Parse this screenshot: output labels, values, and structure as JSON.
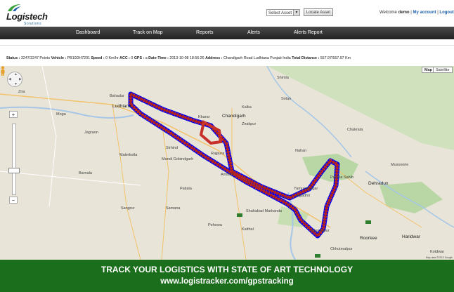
{
  "header": {
    "logo_text": "Logistech",
    "logo_sub": "Solutions",
    "asset_select": {
      "value": "Select Asset"
    },
    "locate_button": "Locate Asset",
    "welcome_prefix": "Welcome",
    "user_name": "demo",
    "my_account": "My account",
    "separator": "|",
    "logout": "Logout"
  },
  "nav": {
    "items": [
      {
        "label": "Dashboard"
      },
      {
        "label": "Track on Map"
      },
      {
        "label": "Reports"
      },
      {
        "label": "Alerts"
      },
      {
        "label": "Alerts Report"
      }
    ]
  },
  "status": {
    "status_label": "Status :",
    "status_value": "3247/3247 Points",
    "vehicle_label": "Vehicle :",
    "vehicle_value": "PB10DH7201",
    "speed_label": "Speed :",
    "speed_value": "0 Km/hr",
    "acc_label": "ACC :",
    "acc_value": "0",
    "gps_label": "GPS :",
    "gps_value": "a",
    "datetime_label": "Date-Time :",
    "datetime_value": "2013-10-08 18:56:26",
    "address_label": "Address :",
    "address_value": "Chandigarh Road Ludhiana Punjab India",
    "distance_label": "Total Distance :",
    "distance_value": "557.97/557.97 Km"
  },
  "map": {
    "map_type_map": "Map",
    "map_type_satellite": "Satellite",
    "zoom_in": "+",
    "zoom_out": "−",
    "colors": {
      "route_track": "#0000ee",
      "route_points": "#c8302a",
      "water": "#a6c6e8",
      "forest": "#b8d7a4"
    },
    "labels": [
      {
        "text": "Ludhiana",
        "kind": "city"
      },
      {
        "text": "Chandigarh",
        "kind": "city"
      },
      {
        "text": "Dehradun",
        "kind": "city"
      },
      {
        "text": "Roorkee",
        "kind": "city"
      },
      {
        "text": "Haridwar",
        "kind": "city"
      },
      {
        "text": "Moga",
        "kind": "town"
      },
      {
        "text": "Barnala",
        "kind": "town"
      },
      {
        "text": "Patiala",
        "kind": "town"
      },
      {
        "text": "Ambala",
        "kind": "town"
      },
      {
        "text": "Sangrur",
        "kind": "town"
      },
      {
        "text": "Zira",
        "kind": "town"
      },
      {
        "text": "Jagraon",
        "kind": "town"
      },
      {
        "text": "Kalka",
        "kind": "town"
      },
      {
        "text": "Zirakpur",
        "kind": "town"
      },
      {
        "text": "Rajpura",
        "kind": "town"
      },
      {
        "text": "Shimla",
        "kind": "town"
      },
      {
        "text": "Solan",
        "kind": "town"
      },
      {
        "text": "Nahan",
        "kind": "town"
      },
      {
        "text": "Kaithal",
        "kind": "town"
      },
      {
        "text": "Mussoorie",
        "kind": "town"
      },
      {
        "text": "Chakrata",
        "kind": "town"
      },
      {
        "text": "Kotdwar",
        "kind": "town"
      },
      {
        "text": "Sirhind",
        "kind": "town"
      },
      {
        "text": "Mandi Gobindgarh",
        "kind": "town"
      },
      {
        "text": "Malerkotla",
        "kind": "town"
      },
      {
        "text": "Samana",
        "kind": "town"
      },
      {
        "text": "Pehowa",
        "kind": "town"
      },
      {
        "text": "Shahabad Markanda",
        "kind": "town"
      },
      {
        "text": "Yamunanagar",
        "kind": "town"
      },
      {
        "text": "Jagadhri",
        "kind": "town"
      },
      {
        "text": "Saharanpur",
        "kind": "town"
      },
      {
        "text": "Chhutmalpur",
        "kind": "town"
      },
      {
        "text": "Paonta Sahib",
        "kind": "town"
      },
      {
        "text": "Bahadur",
        "kind": "town"
      },
      {
        "text": "Kharar",
        "kind": "town"
      }
    ],
    "copyright": "Map data ©2013 Google"
  },
  "banner": {
    "line1": "TRACK YOUR LOGISTICS WITH STATE OF ART TECHNOLOGY",
    "line2": "www.logistracker.com/gpstracking"
  }
}
